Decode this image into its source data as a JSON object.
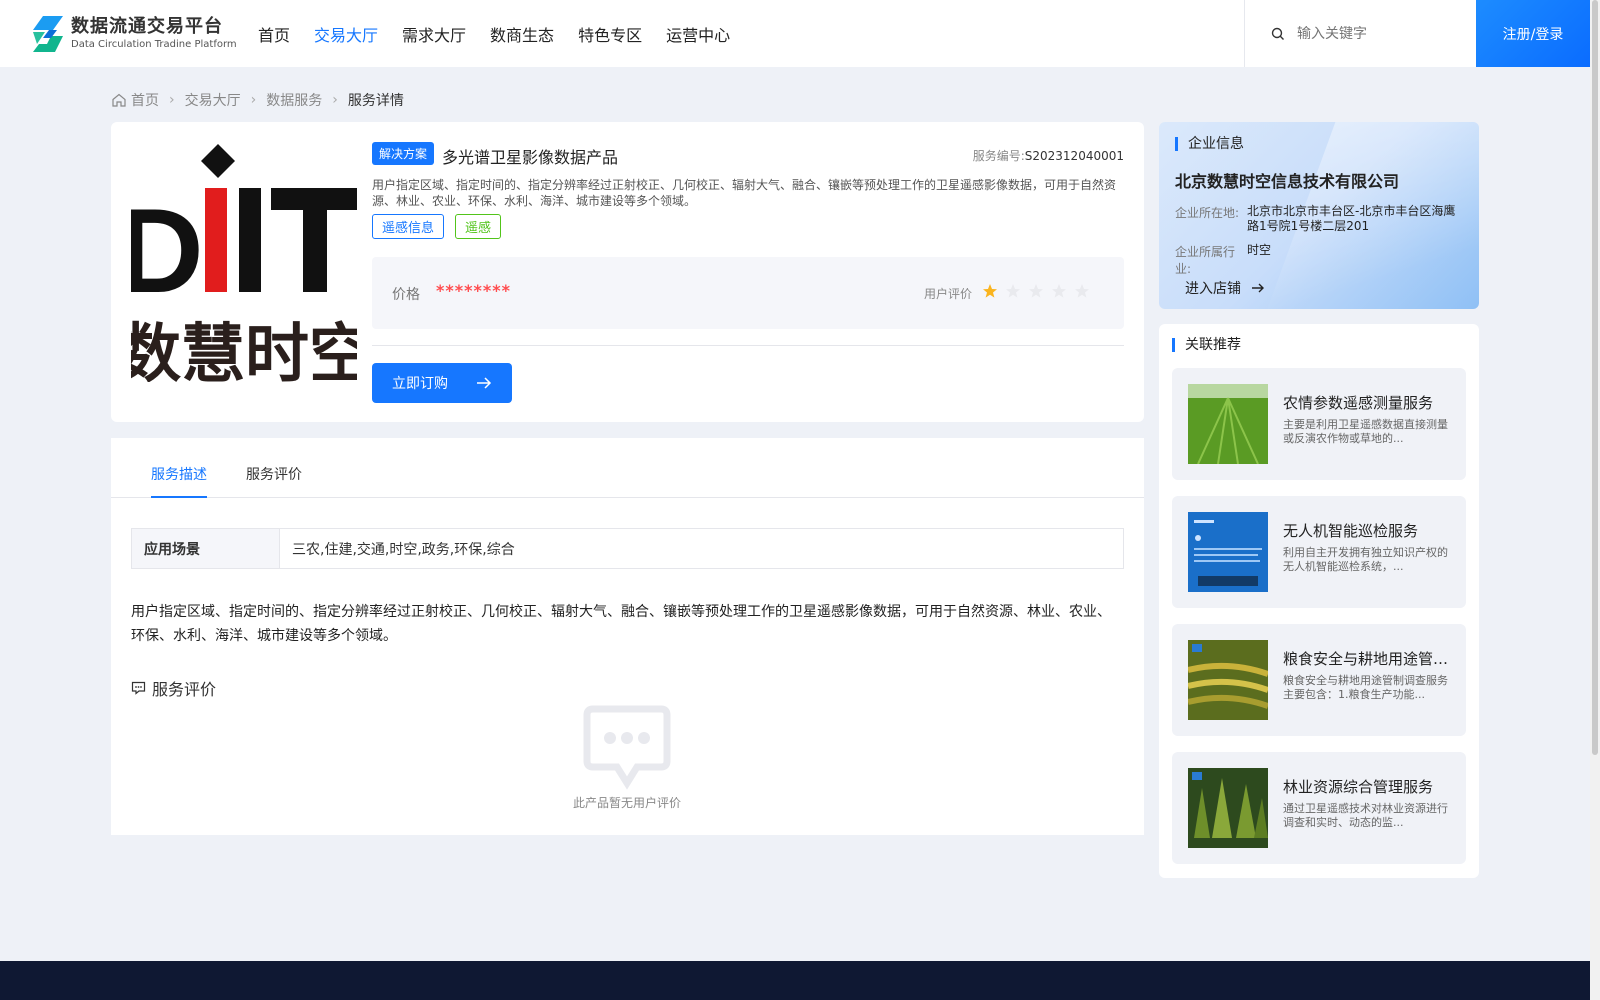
{
  "header": {
    "logo_cn": "数据流通交易平台",
    "logo_en": "Data Circulation Tradine Platform",
    "nav": [
      "首页",
      "交易大厅",
      "需求大厅",
      "数商生态",
      "特色专区",
      "运营中心"
    ],
    "active_nav": "交易大厅",
    "search_placeholder": "输入关键字",
    "login_label": "注册/登录"
  },
  "breadcrumb": [
    "首页",
    "交易大厅",
    "数据服务",
    "服务详情"
  ],
  "product": {
    "logo_text_top": "DIIT",
    "logo_text_bottom": "数慧时空",
    "badge": "解决方案",
    "title": "多光谱卫星影像数据产品",
    "service_no_label": "服务编号:",
    "service_no": "S202312040001",
    "description": "用户指定区域、指定时间的、指定分辨率经过正射校正、几何校正、辐射大气、融合、镶嵌等预处理工作的卫星遥感影像数据，可用于自然资源、林业、农业、环保、水利、海洋、城市建设等多个领域。",
    "tags": [
      "遥感信息",
      "遥感"
    ],
    "price_label": "价格",
    "price_value": "********",
    "rating_label": "用户评价",
    "rating": 1,
    "rating_max": 5,
    "order_label": "立即订购"
  },
  "tabs": [
    "服务描述",
    "服务评价"
  ],
  "active_tab": "服务描述",
  "scene": {
    "label": "应用场景",
    "value": "三农,住建,交通,时空,政务,环保,综合"
  },
  "long_description": "用户指定区域、指定时间的、指定分辨率经过正射校正、几何校正、辐射大气、融合、镶嵌等预处理工作的卫星遥感影像数据，可用于自然资源、林业、农业、环保、水利、海洋、城市建设等多个领域。",
  "review": {
    "heading": "服务评价",
    "empty_text": "此产品暂无用户评价"
  },
  "company": {
    "section_title": "企业信息",
    "name": "北京数慧时空信息技术有限公司",
    "location_label": "企业所在地:",
    "location": "北京市北京市丰台区-北京市丰台区海鹰路1号院1号楼二层201",
    "industry_label": "企业所属行业:",
    "industry": "时空",
    "enter_label": "进入店铺"
  },
  "related": {
    "section_title": "关联推荐",
    "items": [
      {
        "title": "农情参数遥感测量服务",
        "desc": "主要是利用卫星遥感数据直接测量或反演农作物或草地的..."
      },
      {
        "title": "无人机智能巡检服务",
        "desc": "利用自主开发拥有独立知识产权的无人机智能巡检系统，..."
      },
      {
        "title": "粮食安全与耕地用途管制调查",
        "desc": "粮食安全与耕地用途管制调查服务主要包含：1.粮食生产功能..."
      },
      {
        "title": "林业资源综合管理服务",
        "desc": "通过卫星遥感技术对林业资源进行调查和实时、动态的监..."
      }
    ]
  },
  "colors": {
    "primary": "#1677ff",
    "price": "#ff4d4f",
    "star": "#fab41e",
    "tag_green": "#52c41a",
    "footer": "#0f1833"
  }
}
